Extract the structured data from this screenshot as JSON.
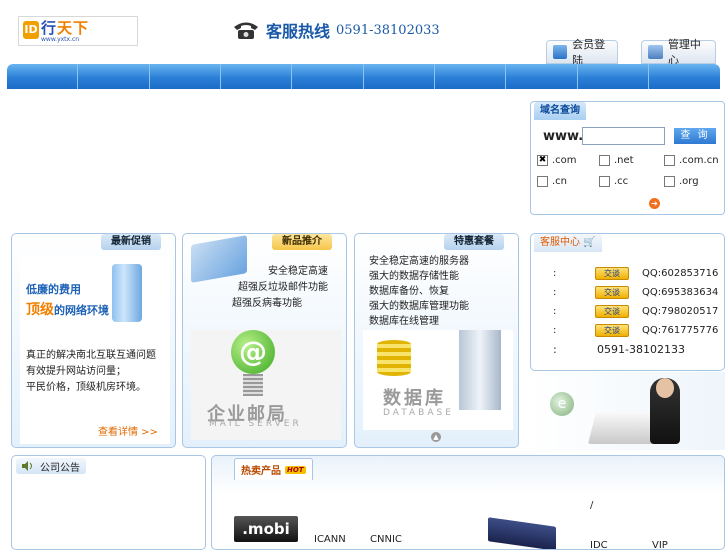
{
  "header": {
    "logo_mark": "ID",
    "logo_text_a": "行",
    "logo_text_b": "天下",
    "logo_sub": "www.yxtx.cn",
    "hotline_label": "客服热线",
    "hotline_number": "0591-38102033",
    "login_label": "会员登陆",
    "admin_label": "管理中心"
  },
  "nav": {
    "items": [
      "",
      "",
      "",
      "",
      "",
      "",
      "",
      "",
      "",
      ""
    ]
  },
  "domain": {
    "title": "域名查询",
    "prefix": "www.",
    "input_value": "",
    "search_label": "查 询",
    "options": [
      {
        "label": ".com",
        "checked": true
      },
      {
        "label": ".net",
        "checked": false
      },
      {
        "label": ".com.cn",
        "checked": false
      },
      {
        "label": ".cn",
        "checked": false
      },
      {
        "label": ".cc",
        "checked": false
      },
      {
        "label": ".org",
        "checked": false
      }
    ]
  },
  "promo": {
    "title": "最新促销",
    "line1": "低廉的费用",
    "line2_big": "顶级",
    "line2_rest": "的网络环境",
    "desc": [
      "真正的解决南北互联互通问题",
      "有效提升网站访问量；",
      "平民价格，顶级机房环境。"
    ],
    "more": "查看详情 >>"
  },
  "newprod": {
    "title": "新品推介",
    "features": [
      "安全稳定高速",
      "超强反垃圾邮件功能",
      "超强反病毒功能"
    ],
    "img_title": "企业邮局",
    "img_sub": "MAIL SERVER"
  },
  "special": {
    "title": "特惠套餐",
    "features": [
      "安全稳定高速的服务器",
      "强大的数据存储性能",
      "数据库备份、恢复",
      "强大的数据库管理功能",
      "数据库在线管理"
    ],
    "img_title": "数据库",
    "img_sub": "DATABASE"
  },
  "service": {
    "title": "客服中心",
    "colon": ":",
    "talk_label": "交谈",
    "rows": [
      {
        "qq": "QQ:602853716"
      },
      {
        "qq": "QQ:695383634"
      },
      {
        "qq": "QQ:798020517"
      },
      {
        "qq": "QQ:761775776"
      }
    ],
    "phone": "0591-38102133"
  },
  "notice": {
    "title": "公司公告"
  },
  "hot": {
    "title": "热卖产品",
    "badge": "HOT",
    "mobi": ".mobi",
    "labels": {
      "icann": "ICANN",
      "cnnic": "CNNIC",
      "slash": "/",
      "idc": "IDC",
      "vip": "VIP"
    }
  },
  "colors": {
    "brand_blue": "#1a59a8",
    "accent_orange": "#f08000",
    "nav_blue": "#2b7fd8"
  }
}
